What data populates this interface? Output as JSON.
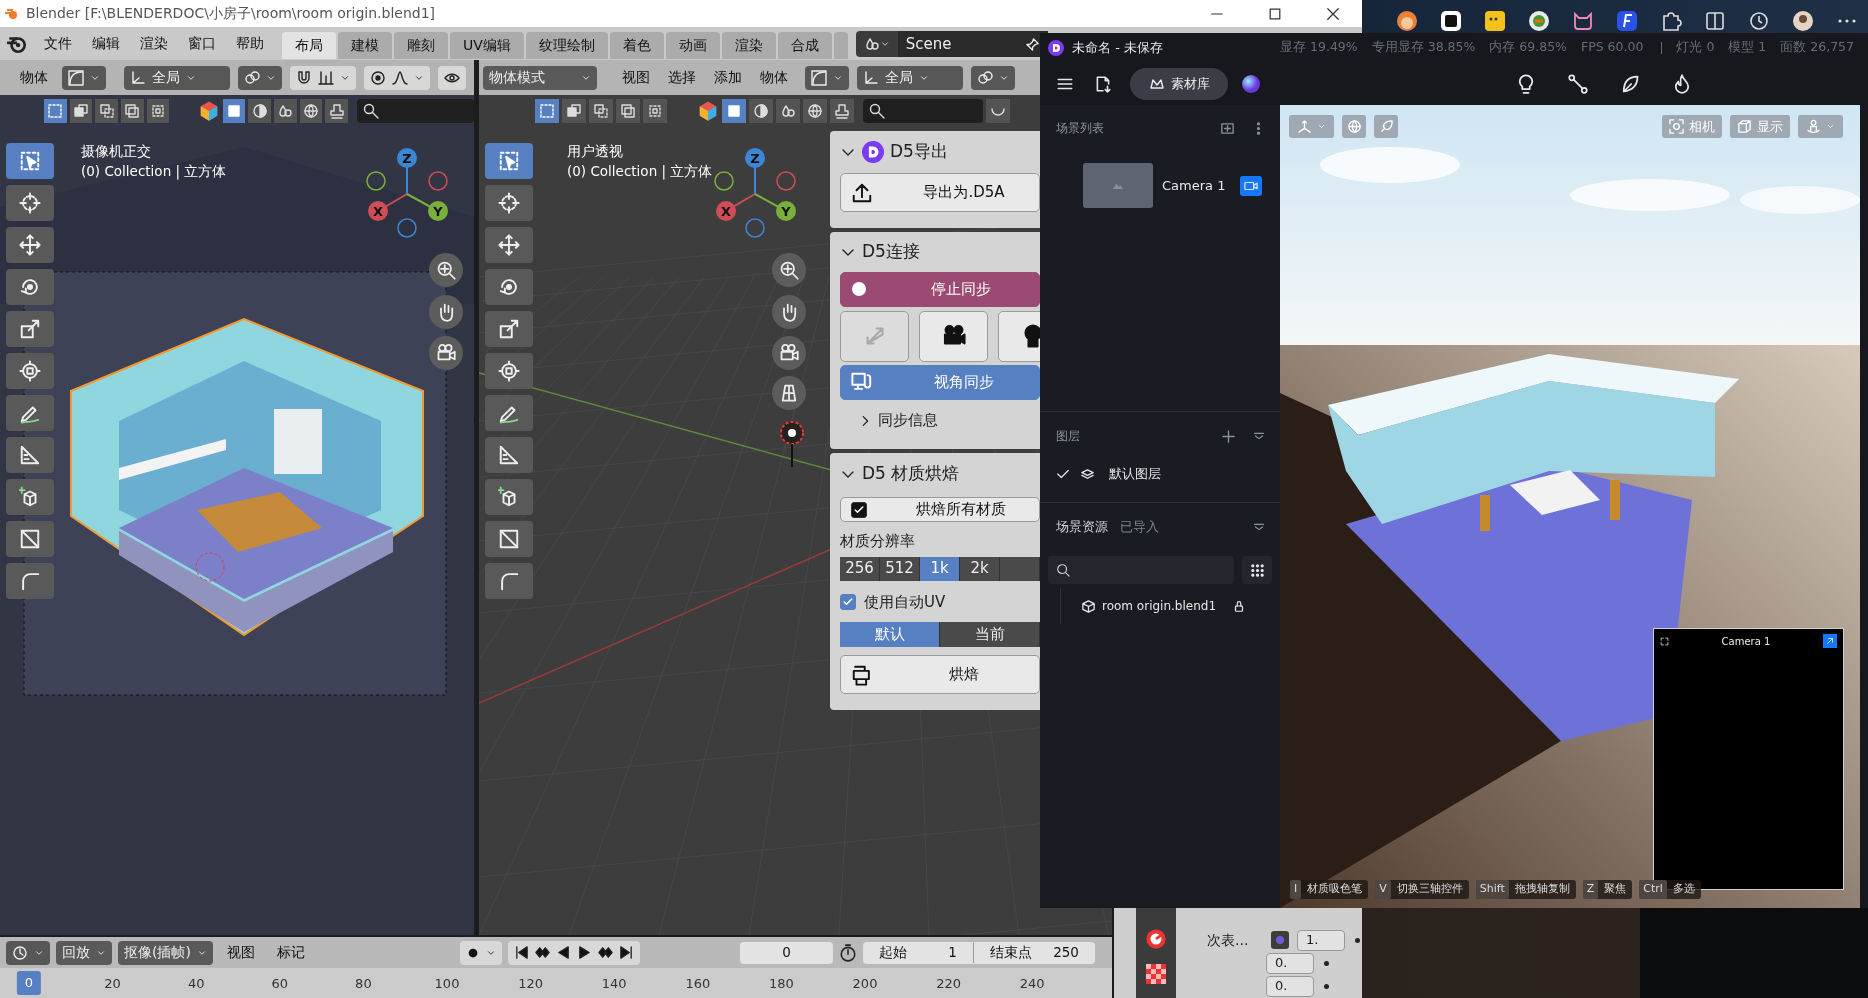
{
  "blender": {
    "title": "Blender [F:\\BLENDERDOC\\小房子\\room\\room origin.blend1]",
    "menu": [
      "文件",
      "编辑",
      "渲染",
      "窗口",
      "帮助"
    ],
    "workspaces": [
      {
        "label": "布局",
        "selected": true
      },
      {
        "label": "建模",
        "selected": false
      },
      {
        "label": "雕刻",
        "selected": false
      },
      {
        "label": "UV编辑",
        "selected": false
      },
      {
        "label": "纹理绘制",
        "selected": false
      },
      {
        "label": "着色",
        "selected": false
      },
      {
        "label": "动画",
        "selected": false
      },
      {
        "label": "渲染",
        "selected": false
      },
      {
        "label": "合成",
        "selected": false
      }
    ],
    "scene": "Scene",
    "left_view": {
      "object_label": "物体",
      "orientation": "全局",
      "view_name": "摄像机正交",
      "collection": "(0) Collection | 立方体",
      "axes": [
        "X",
        "Y",
        "Z"
      ],
      "tools": [
        {
          "selected": true
        },
        {
          "selected": false
        },
        {
          "selected": false
        },
        {
          "selected": false
        },
        {
          "selected": false
        },
        {
          "selected": false
        },
        {
          "selected": false
        },
        {
          "selected": false
        },
        {
          "selected": false
        },
        {
          "selected": false
        },
        {
          "selected": false
        }
      ]
    },
    "right_view": {
      "mode": "物体模式",
      "menu": [
        "视图",
        "选择",
        "添加",
        "物体"
      ],
      "orientation": "全局",
      "view_name": "用户透视",
      "collection": "(0) Collection | 立方体",
      "axes": [
        "X",
        "Y",
        "Z"
      ],
      "tools": [
        {
          "selected": true
        },
        {
          "selected": false
        },
        {
          "selected": false
        },
        {
          "selected": false
        },
        {
          "selected": false
        },
        {
          "selected": false
        },
        {
          "selected": false
        },
        {
          "selected": false
        },
        {
          "selected": false
        },
        {
          "selected": false
        },
        {
          "selected": false
        }
      ]
    },
    "d5_panel": {
      "export": {
        "title": "D5导出",
        "expanded": true,
        "button": "导出为.D5A"
      },
      "connect": {
        "title": "D5连接",
        "expanded": true,
        "stop_button": "停止同步",
        "sync_buttons": [
          {
            "disabled": true
          },
          {
            "disabled": false
          },
          {
            "disabled": false
          }
        ],
        "view_sync": "视角同步",
        "sync_info": "同步信息",
        "sync_info_expanded": false
      },
      "bake": {
        "title": "D5 材质烘焙",
        "expanded": true,
        "bake_all": "烘焙所有材质",
        "bake_all_checked": true,
        "resolution_label": "材质分辨率",
        "resolutions": [
          {
            "label": "256",
            "selected": false
          },
          {
            "label": "512",
            "selected": false
          },
          {
            "label": "1k",
            "selected": true
          },
          {
            "label": "2k",
            "selected": false
          }
        ],
        "auto_uv": "使用自动UV",
        "auto_uv_checked": true,
        "modes": [
          {
            "label": "默认",
            "selected": true
          },
          {
            "label": "当前",
            "selected": false
          }
        ],
        "bake_button": "烘焙"
      }
    },
    "timeline": {
      "playback": "回放",
      "keying": "抠像(插帧)",
      "menu": [
        "视图",
        "标记"
      ],
      "current_frame": "0",
      "start_label": "起始",
      "start": "1",
      "end_label": "结束点",
      "end": "250",
      "ruler": [
        {
          "label": "0",
          "current": true
        },
        {
          "label": "20",
          "current": false
        },
        {
          "label": "40",
          "current": false
        },
        {
          "label": "60",
          "current": false
        },
        {
          "label": "80",
          "current": false
        },
        {
          "label": "100",
          "current": false
        },
        {
          "label": "120",
          "current": false
        },
        {
          "label": "140",
          "current": false
        },
        {
          "label": "160",
          "current": false
        },
        {
          "label": "180",
          "current": false
        },
        {
          "label": "200",
          "current": false
        },
        {
          "label": "220",
          "current": false
        },
        {
          "label": "240",
          "current": false
        }
      ]
    },
    "properties": {
      "label": "次表...",
      "values": [
        "1.",
        "0.",
        "0."
      ]
    }
  },
  "d5": {
    "title": "未命名 - 未保存",
    "stats": [
      "显存 19.49%",
      "专用显存 38.85%",
      "内存 69.85%",
      "FPS 60.00"
    ],
    "counts": [
      "灯光 0",
      "模型 1",
      "面数 26,757"
    ],
    "library_button": "素材库",
    "scene_list": {
      "title": "场景列表",
      "cameras": [
        {
          "name": "Camera 1",
          "active": true
        }
      ]
    },
    "layers": {
      "title": "图层",
      "items": [
        {
          "name": "默认图层",
          "visible": true
        }
      ]
    },
    "assets": {
      "tabs": [
        {
          "label": "场景资源",
          "selected": true
        },
        {
          "label": "已导入",
          "selected": false
        }
      ],
      "items": [
        {
          "name": "room origin.blend1",
          "locked": true
        }
      ]
    },
    "viewport": {
      "camera_button": "相机",
      "display_button": "显示",
      "preview_title": "Camera 1",
      "shortcuts": [
        {
          "key": "I",
          "action": "材质吸色笔"
        },
        {
          "key": "V",
          "action": "切换三轴控件"
        },
        {
          "key": "Shift",
          "action": "拖拽轴复制"
        },
        {
          "key": "Z",
          "action": "聚焦"
        },
        {
          "key": "Ctrl",
          "action": "多选"
        }
      ]
    }
  }
}
